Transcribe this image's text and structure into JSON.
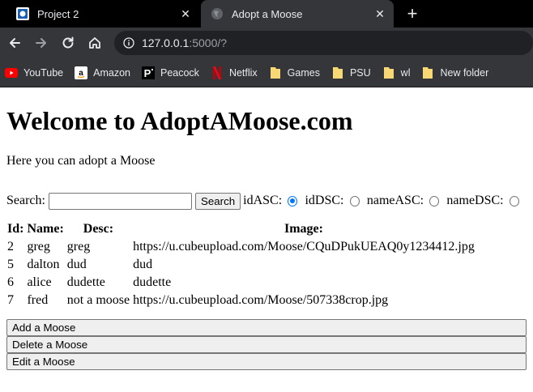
{
  "browser": {
    "tabs": [
      {
        "title": "Project 2",
        "icon": "project-favicon-icon",
        "active": false
      },
      {
        "title": "Adopt a Moose",
        "icon": "globe-icon",
        "active": true
      }
    ],
    "new_tab_icon": "plus-icon",
    "address": {
      "host": "127.0.0.1",
      "rest": ":5000/?"
    },
    "bookmarks": [
      {
        "label": "YouTube",
        "icon": "youtube-icon",
        "color": "#ff0000"
      },
      {
        "label": "Amazon",
        "icon": "amazon-icon",
        "color": "#ffffff"
      },
      {
        "label": "Peacock",
        "icon": "peacock-icon",
        "color": "#ffffff"
      },
      {
        "label": "Netflix",
        "icon": "netflix-icon",
        "color": "#e50914"
      },
      {
        "label": "Games",
        "icon": "folder-icon",
        "color": "#f8d775"
      },
      {
        "label": "PSU",
        "icon": "folder-icon",
        "color": "#f8d775"
      },
      {
        "label": "wl",
        "icon": "folder-icon",
        "color": "#f8d775"
      },
      {
        "label": "New folder",
        "icon": "folder-icon",
        "color": "#f8d775"
      }
    ]
  },
  "page": {
    "heading": "Welcome to AdoptAMoose.com",
    "intro": "Here you can adopt a Moose",
    "search": {
      "label": "Search:",
      "value": "",
      "button": "Search",
      "sort_options": [
        {
          "label": "idASC:",
          "checked": true
        },
        {
          "label": "idDSC:",
          "checked": false
        },
        {
          "label": "nameASC:",
          "checked": false
        },
        {
          "label": "nameDSC:",
          "checked": false
        }
      ]
    },
    "table": {
      "headers": [
        "Id:",
        "Name:",
        "Desc:",
        "Image:"
      ],
      "rows": [
        [
          "2",
          "greg",
          "greg",
          "https://u.cubeupload.com/Moose/CQuDPukUEAQ0y1234412.jpg"
        ],
        [
          "5",
          "dalton",
          "dud",
          "dud"
        ],
        [
          "6",
          "alice",
          "dudette",
          "dudette"
        ],
        [
          "7",
          "fred",
          "not a moose",
          "https://u.cubeupload.com/Moose/507338crop.jpg"
        ]
      ]
    },
    "actions": [
      "Add a Moose",
      "Delete a Moose",
      "Edit a Moose"
    ]
  }
}
